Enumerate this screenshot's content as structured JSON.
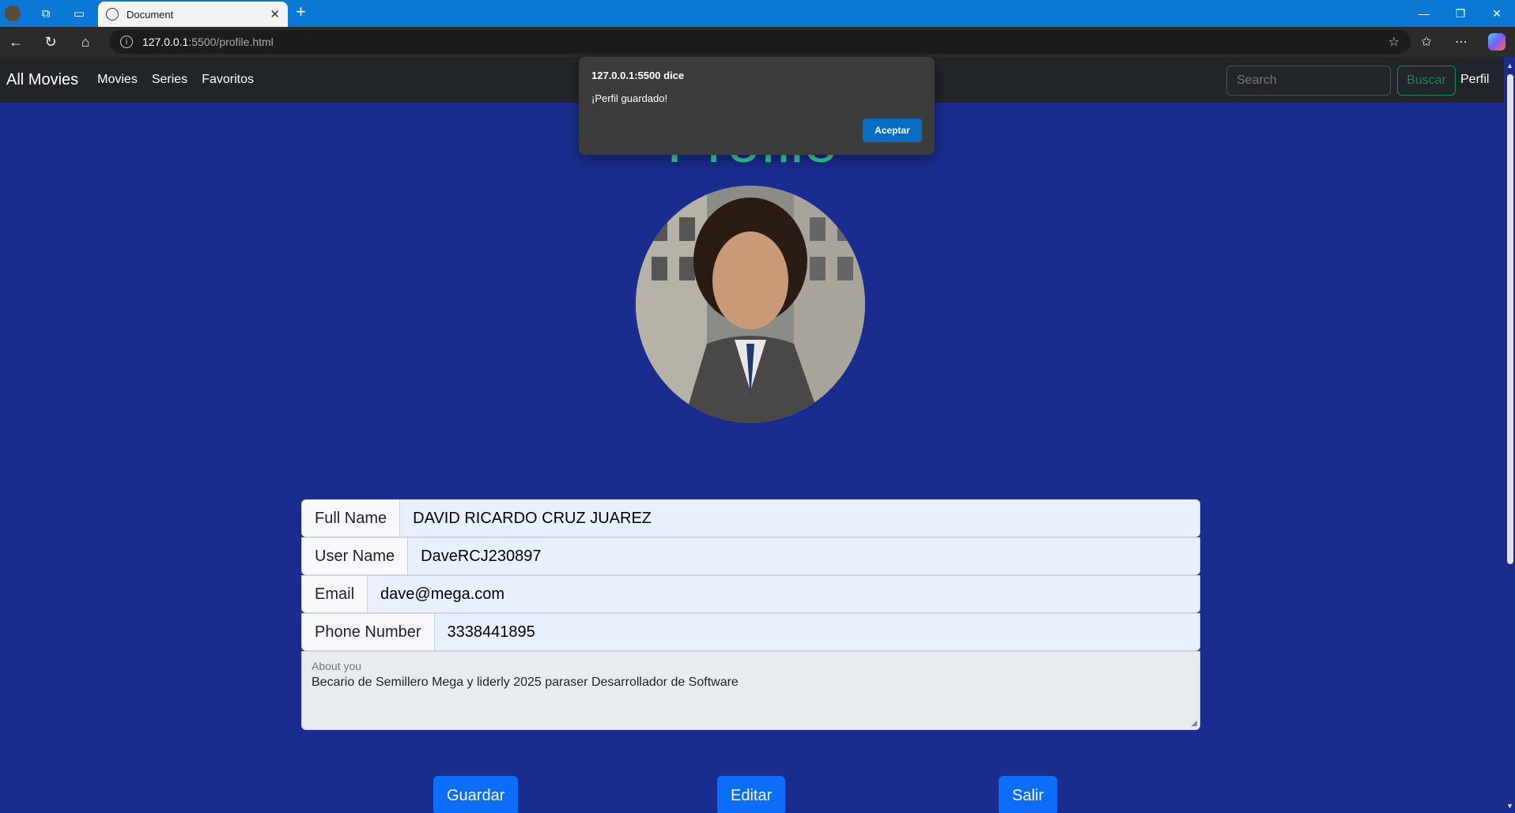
{
  "browser": {
    "tab_title": "Document",
    "url_host": "127.0.0.1",
    "url_path": ":5500/profile.html"
  },
  "navbar": {
    "brand": "All Movies",
    "links": [
      "Movies",
      "Series",
      "Favoritos"
    ],
    "search_placeholder": "Search",
    "search_button": "Buscar",
    "profile_link": "Perfil"
  },
  "page": {
    "title": "Profile"
  },
  "form": {
    "full_name_label": "Full Name",
    "full_name_value": "DAVID RICARDO CRUZ JUAREZ",
    "user_name_label": "User Name",
    "user_name_value": "DaveRCJ230897",
    "email_label": "Email",
    "email_value": "dave@mega.com",
    "phone_label": "Phone Number",
    "phone_value": "3338441895",
    "about_label": "About you",
    "about_value": "Becario de Semillero Mega y liderly 2025 paraser Desarrollador de Software"
  },
  "buttons": {
    "save": "Guardar",
    "edit": "Editar",
    "exit": "Salir"
  },
  "dialog": {
    "title": "127.0.0.1:5500 dice",
    "message": "¡Perfil guardado!",
    "accept": "Aceptar"
  },
  "colors": {
    "page_bg": "#1a2d8f",
    "navbar_bg": "#212529",
    "button_primary": "#0d6efd",
    "title_accent": "#40d0a0",
    "browser_accent": "#0a78d4"
  }
}
